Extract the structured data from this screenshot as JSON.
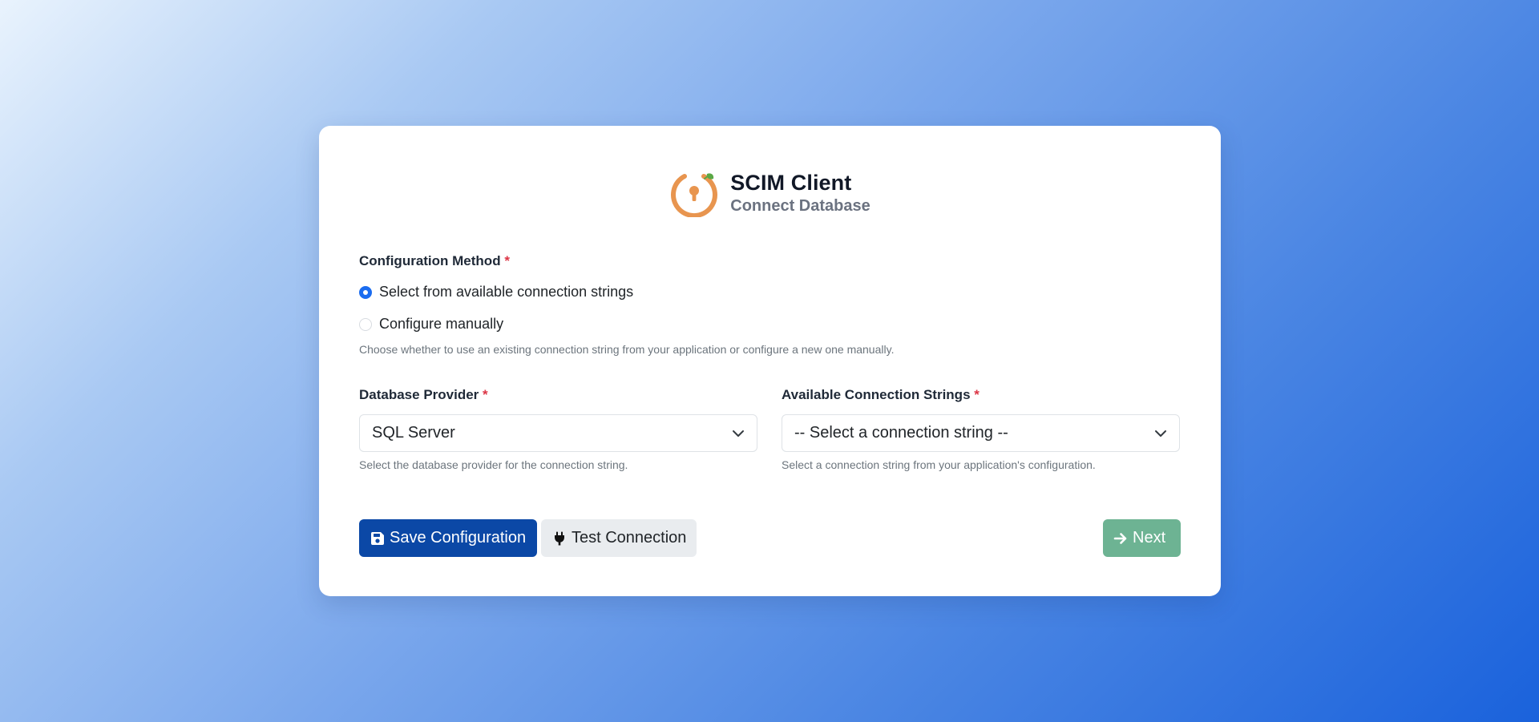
{
  "brand": {
    "title": "SCIM Client",
    "subtitle": "Connect Database",
    "logo_icon": "keyhole-ring-logo-icon",
    "logo_color": "#e8954f",
    "leaf_color": "#5aa845"
  },
  "config_method": {
    "label": "Configuration Method",
    "required_mark": "*",
    "options": [
      {
        "label": "Select from available connection strings",
        "checked": true
      },
      {
        "label": "Configure manually",
        "checked": false
      }
    ],
    "help": "Choose whether to use an existing connection string from your application or configure a new one manually."
  },
  "provider": {
    "label": "Database Provider",
    "required_mark": "*",
    "value": "SQL Server",
    "help": "Select the database provider for the connection string."
  },
  "connection": {
    "label": "Available Connection Strings",
    "required_mark": "*",
    "value": "-- Select a connection string --",
    "help": "Select a connection string from your application's configuration."
  },
  "buttons": {
    "save": {
      "label": "Save Configuration",
      "icon": "floppy-disk-icon"
    },
    "test": {
      "label": "Test Connection",
      "icon": "plug-icon"
    },
    "next": {
      "label": "Next",
      "icon": "arrow-right-icon"
    }
  },
  "colors": {
    "accent": "#1a6cf0",
    "primary": "#0b48a6",
    "success": "#6db393",
    "required": "#dc3545"
  }
}
